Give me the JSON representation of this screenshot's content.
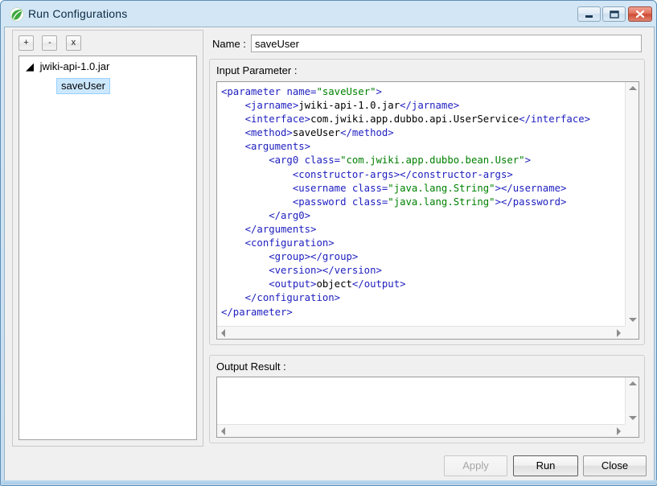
{
  "window": {
    "title": "Run Configurations",
    "icon": "green-leaf-icon",
    "controls": {
      "minimize": "minimize-button",
      "maximize": "maximize-button",
      "close": "close-button"
    }
  },
  "left_panel": {
    "toolbar": [
      {
        "name": "add",
        "label": "+"
      },
      {
        "name": "remove",
        "label": "-"
      },
      {
        "name": "delete",
        "label": "x"
      }
    ],
    "tree": {
      "expander": "◢",
      "root_label": "jwiki-api-1.0.jar",
      "child_label": "saveUser",
      "child_selected": true
    }
  },
  "name_field": {
    "label": "Name :",
    "value": "saveUser",
    "placeholder": ""
  },
  "input_parameter": {
    "label": "Input Parameter :",
    "lines": [
      [
        {
          "t": "tg",
          "s": "<parameter "
        },
        {
          "t": "at",
          "s": "name="
        },
        {
          "t": "av",
          "s": "\"saveUser\""
        },
        {
          "t": "tg",
          "s": ">"
        }
      ],
      [
        {
          "t": "tg",
          "s": "    <jarname>"
        },
        {
          "t": "tx",
          "s": "jwiki-api-1.0.jar"
        },
        {
          "t": "tg",
          "s": "</jarname>"
        }
      ],
      [
        {
          "t": "tg",
          "s": "    <interface>"
        },
        {
          "t": "tx",
          "s": "com.jwiki.app.dubbo.api.UserService"
        },
        {
          "t": "tg",
          "s": "</interface>"
        }
      ],
      [
        {
          "t": "tg",
          "s": "    <method>"
        },
        {
          "t": "tx",
          "s": "saveUser"
        },
        {
          "t": "tg",
          "s": "</method>"
        }
      ],
      [
        {
          "t": "tg",
          "s": "    <arguments>"
        }
      ],
      [
        {
          "t": "tg",
          "s": "        <arg0 "
        },
        {
          "t": "at",
          "s": "class="
        },
        {
          "t": "av",
          "s": "\"com.jwiki.app.dubbo.bean.User\""
        },
        {
          "t": "tg",
          "s": ">"
        }
      ],
      [
        {
          "t": "tg",
          "s": "            <constructor-args></constructor-args>"
        }
      ],
      [
        {
          "t": "tg",
          "s": "            <username "
        },
        {
          "t": "at",
          "s": "class="
        },
        {
          "t": "av",
          "s": "\"java.lang.String\""
        },
        {
          "t": "tg",
          "s": "></username>"
        }
      ],
      [
        {
          "t": "tg",
          "s": "            <password "
        },
        {
          "t": "at",
          "s": "class="
        },
        {
          "t": "av",
          "s": "\"java.lang.String\""
        },
        {
          "t": "tg",
          "s": "></password>"
        }
      ],
      [
        {
          "t": "tg",
          "s": "        </arg0>"
        }
      ],
      [
        {
          "t": "tg",
          "s": "    </arguments>"
        }
      ],
      [
        {
          "t": "tg",
          "s": "    <configuration>"
        }
      ],
      [
        {
          "t": "tg",
          "s": "        <group></group>"
        }
      ],
      [
        {
          "t": "tg",
          "s": "        <version></version>"
        }
      ],
      [
        {
          "t": "tg",
          "s": "        <output>"
        },
        {
          "t": "tx",
          "s": "object"
        },
        {
          "t": "tg",
          "s": "</output>"
        }
      ],
      [
        {
          "t": "tg",
          "s": "    </configuration>"
        }
      ],
      [
        {
          "t": "tg",
          "s": "</parameter>"
        }
      ]
    ]
  },
  "output_result": {
    "label": "Output Result :",
    "value": ""
  },
  "buttons": {
    "apply": {
      "label": "Apply",
      "enabled": false
    },
    "run": {
      "label": "Run",
      "enabled": true,
      "default": true
    },
    "close": {
      "label": "Close",
      "enabled": true
    }
  },
  "colors": {
    "titlebar_accent": "#cfe3f3",
    "selection": "#cce8ff",
    "tag": "#2020c0",
    "attr_value": "#008000",
    "close_button": "#cf4a33"
  }
}
